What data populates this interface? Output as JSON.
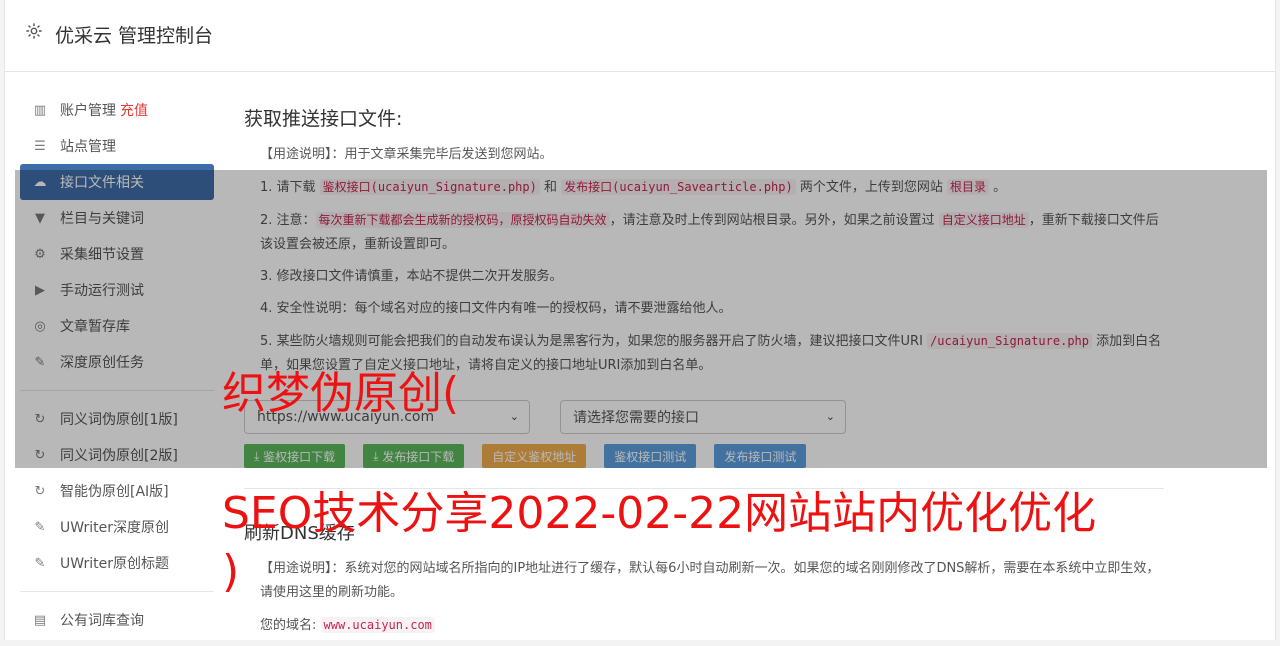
{
  "header": {
    "title": "优采云 管理控制台",
    "icon": "gear-icon"
  },
  "sidebar": {
    "items": [
      {
        "label": "账户管理",
        "badge": "充值",
        "icon": "bar-chart-icon"
      },
      {
        "label": "站点管理",
        "icon": "server-icon"
      },
      {
        "label": "接口文件相关",
        "icon": "cloud-upload-icon",
        "active": true
      },
      {
        "label": "栏目与关键词",
        "icon": "filter-icon"
      },
      {
        "label": "采集细节设置",
        "icon": "gears-icon"
      },
      {
        "label": "手动运行测试",
        "icon": "play-icon"
      },
      {
        "label": "文章暂存库",
        "icon": "database-icon"
      },
      {
        "label": "深度原创任务",
        "icon": "edit-icon"
      },
      {
        "label": "同义词伪原创[1版]",
        "icon": "refresh-icon"
      },
      {
        "label": "同义词伪原创[2版]",
        "icon": "refresh-icon"
      },
      {
        "label": "智能伪原创[AI版]",
        "icon": "refresh-icon"
      },
      {
        "label": "UWriter深度原创",
        "icon": "edit-icon"
      },
      {
        "label": "UWriter原创标题",
        "icon": "edit-icon"
      },
      {
        "label": "公有词库查询",
        "icon": "book-icon"
      }
    ]
  },
  "main": {
    "title": "获取推送接口文件:",
    "usage": "【用途说明】：用于文章采集完毕后发送到您网站。",
    "p1": {
      "a": "1. 请下载 ",
      "c1": "鉴权接口(ucaiyun_Signature.php)",
      "b": " 和 ",
      "c2": "发布接口(ucaiyun_Savearticle.php)",
      "d": " 两个文件，上传到您网站 ",
      "c3": "根目录",
      "e": " 。"
    },
    "p2": {
      "a": "2. 注意：",
      "c1": "每次重新下载都会生成新的授权码，原授权码自动失效",
      "b": "，请注意及时上传到网站根目录。另外，如果之前设置过 ",
      "c2": "自定义接口地址",
      "d": "，重新下载接口文件后该设置会被还原，重新设置即可。"
    },
    "p3": "3. 修改接口文件请慎重，本站不提供二次开发服务。",
    "p4": "4. 安全性说明：每个域名对应的接口文件内有唯一的授权码，请不要泄露给他人。",
    "p5": {
      "a": "5. 某些防火墙规则可能会把我们的自动发布误认为是黑客行为，如果您的服务器开启了防火墙，建议把接口文件URI ",
      "c1": "/ucaiyun_Signature.php",
      "b": " 添加到白名单，如果您设置了自定义接口地址，请将自定义的接口地址URI添加到白名单。"
    },
    "site_select": "https://www.ucaiyun.com",
    "api_select": "请选择您需要的接口",
    "buttons": {
      "b1": "鉴权接口下载",
      "b2": "发布接口下载",
      "b3": "自定义鉴权地址",
      "b4": "鉴权接口测试",
      "b5": "发布接口测试"
    },
    "dns_title": "刷新DNS缓存",
    "dns_usage": "【用途说明】：系统对您的网站域名所指向的IP地址进行了缓存，默认每6小时自动刷新一次。如果您的域名刚刚修改了DNS解析，需要在本系统中立即生效，请使用这里的刷新功能。",
    "domain_label": "您的域名:",
    "domain_value": "www.ucaiyun.com"
  },
  "watermark": {
    "line1": "织梦伪原创(",
    "line2": "SEO技术分享2022-02-22网站站内优化优化",
    "line3": ")"
  },
  "colors": {
    "active_nav": "#3d6da8",
    "watermark": "#ee1111",
    "code": "#c7254e"
  }
}
